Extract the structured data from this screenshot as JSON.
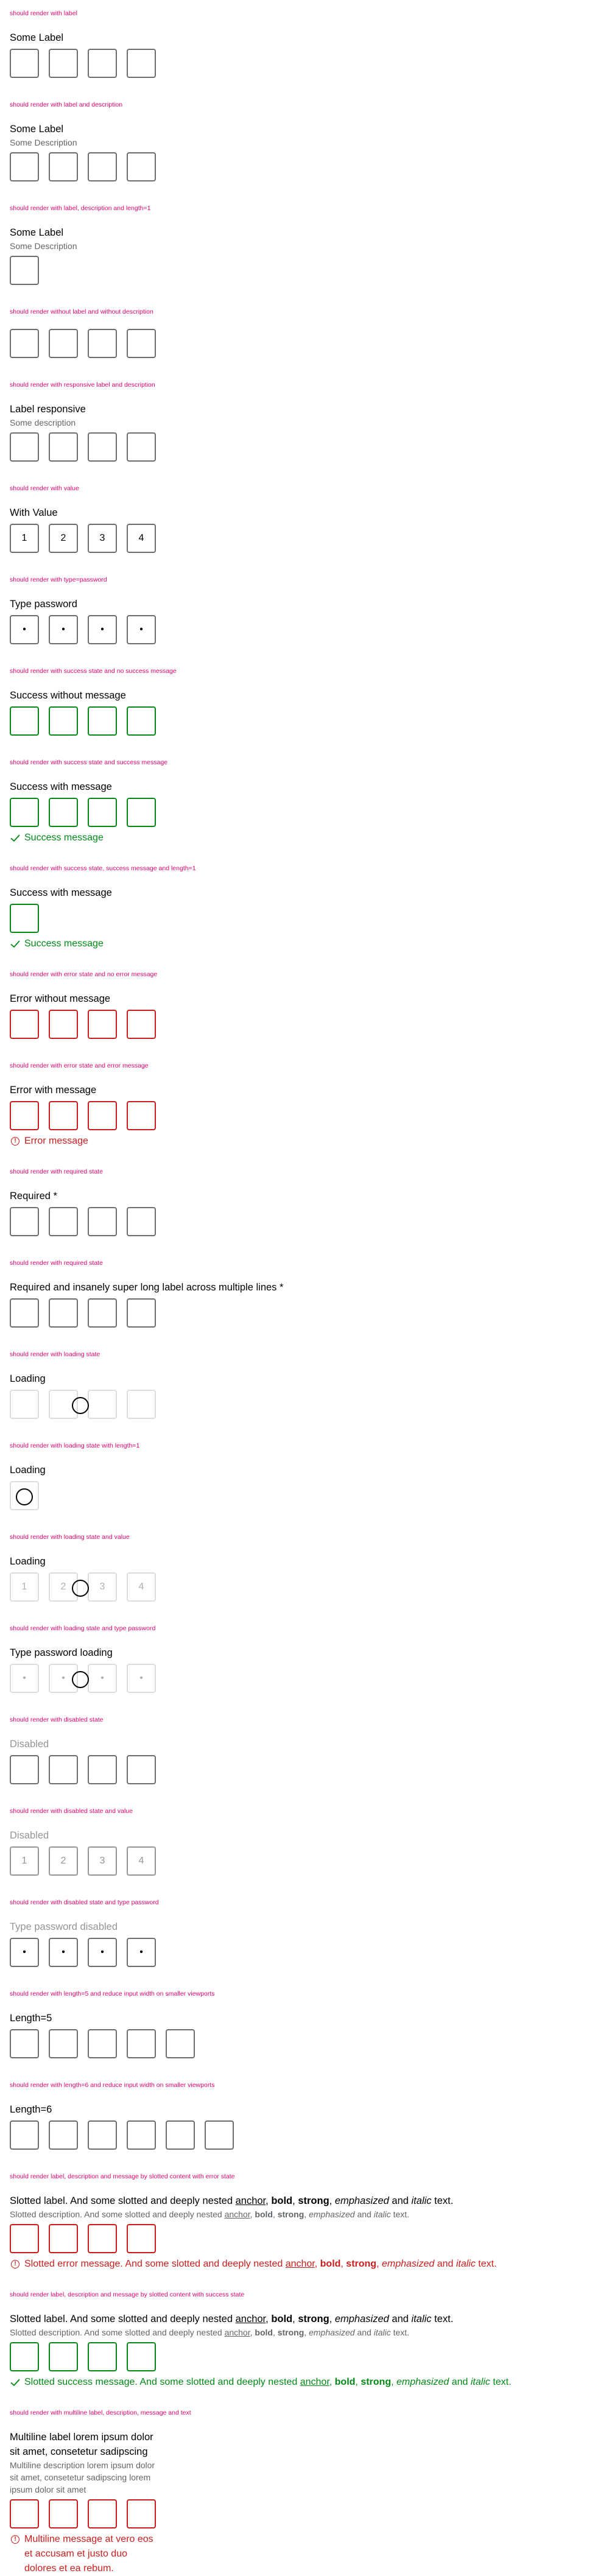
{
  "sections": {
    "s1": {
      "story": "should render with label",
      "label": "Some Label"
    },
    "s2": {
      "story": "should render with label and description",
      "label": "Some Label",
      "description": "Some Description"
    },
    "s3": {
      "story": "should render with label, description and length=1",
      "label": "Some Label",
      "description": "Some Description"
    },
    "s4": {
      "story": "should render without label and without description"
    },
    "s5": {
      "story": "should render with responsive label and description",
      "label": "Label responsive",
      "description": "Some description"
    },
    "s6": {
      "story": "should render with value",
      "label": "With Value",
      "values": [
        "1",
        "2",
        "3",
        "4"
      ]
    },
    "s7": {
      "story": "should render with type=password",
      "label": "Type password",
      "values": [
        "•",
        "•",
        "•",
        "•"
      ]
    },
    "s8": {
      "story": "should render with success state and no success message",
      "label": "Success without message"
    },
    "s9": {
      "story": "should render with success state and success message",
      "label": "Success with message",
      "message": "Success message"
    },
    "s10": {
      "story": "should render with success state, success message and length=1",
      "label": "Success with message",
      "message": "Success message"
    },
    "s11": {
      "story": "should render with error state and no error message",
      "label": "Error without message"
    },
    "s12": {
      "story": "should render with error state and error message",
      "label": "Error with message",
      "message": "Error message"
    },
    "s13": {
      "story": "should render with required state",
      "label": "Required *"
    },
    "s14": {
      "story": "should render with required state",
      "label": "Required and insanely super long label across multiple lines *"
    },
    "s15": {
      "story": "should render with loading state",
      "label": "Loading"
    },
    "s16": {
      "story": "should render with loading state with length=1",
      "label": "Loading"
    },
    "s17": {
      "story": "should render with loading state and value",
      "label": "Loading",
      "values": [
        "1",
        "2",
        "3",
        "4"
      ]
    },
    "s18": {
      "story": "should render with loading state and type password",
      "label": "Type password loading",
      "values": [
        "•",
        "•",
        "•",
        "•"
      ]
    },
    "s19": {
      "story": "should render with disabled state",
      "label": "Disabled"
    },
    "s20": {
      "story": "should render with disabled state and value",
      "label": "Disabled",
      "values": [
        "1",
        "2",
        "3",
        "4"
      ]
    },
    "s21": {
      "story": "should render with disabled state and type password",
      "label": "Type password disabled",
      "values": [
        "•",
        "•",
        "•",
        "•"
      ]
    },
    "s22": {
      "story": "should render with length=5 and reduce input width on smaller viewports",
      "label": "Length=5"
    },
    "s23": {
      "story": "should render with length=6 and reduce input width on smaller viewports",
      "label": "Length=6"
    },
    "s24": {
      "story": "should render label, description and message by slotted content with error state",
      "label": {
        "t1": "Slotted label. And some slotted and deeply nested ",
        "anchor": "anchor",
        "t2": ", ",
        "bold": "bold",
        "t3": ", ",
        "strong": "strong",
        "t4": ", ",
        "em": "emphasized",
        "t5": " and ",
        "italic": "italic",
        "t6": " text."
      },
      "description": {
        "t1": "Slotted description. And some slotted and deeply nested ",
        "anchor": "anchor",
        "t2": ", ",
        "bold": "bold",
        "t3": ", ",
        "strong": "strong",
        "t4": ", ",
        "em": "emphasized",
        "t5": " and ",
        "italic": "italic",
        "t6": " text."
      },
      "message": {
        "t1": "Slotted error message. And some slotted and deeply nested ",
        "anchor": "anchor",
        "t2": ", ",
        "bold": "bold",
        "t3": ", ",
        "strong": "strong",
        "t4": ", ",
        "em": "emphasized",
        "t5": " and ",
        "italic": "italic",
        "t6": " text."
      }
    },
    "s25": {
      "story": "should render label, description and message by slotted content with success state",
      "label": {
        "t1": "Slotted label. And some slotted and deeply nested ",
        "anchor": "anchor",
        "t2": ", ",
        "bold": "bold",
        "t3": ", ",
        "strong": "strong",
        "t4": ", ",
        "em": "emphasized",
        "t5": " and ",
        "italic": "italic",
        "t6": " text."
      },
      "description": {
        "t1": "Slotted description. And some slotted and deeply nested ",
        "anchor": "anchor",
        "t2": ", ",
        "bold": "bold",
        "t3": ", ",
        "strong": "strong",
        "t4": ", ",
        "em": "emphasized",
        "t5": " and ",
        "italic": "italic",
        "t6": " text."
      },
      "message": {
        "t1": "Slotted success message. And some slotted and deeply nested ",
        "anchor": "anchor",
        "t2": ", ",
        "bold": "bold",
        "t3": ", ",
        "strong": "strong",
        "t4": ", ",
        "em": "emphasized",
        "t5": " and ",
        "italic": "italic",
        "t6": " text."
      }
    },
    "s26": {
      "story": "should render with multiline label, description, message and text",
      "label": "Multiline label lorem ipsum dolor sit amet, consetetur sadipscing",
      "description": "Multiline description lorem ipsum dolor sit amet, consetetur sadipscing lorem ipsum dolor sit amet",
      "message": "Multiline message at vero eos et accusam et justo duo dolores et ea rebum."
    }
  },
  "colors": {
    "story": "#e0066e",
    "success": "#018a16",
    "error": "#cc1d1d",
    "border": "#6b6d70",
    "disabled": "#949598",
    "text": "#010205",
    "muted": "#626669"
  },
  "icons": {
    "success": "check-icon",
    "error": "exclamation-icon",
    "loading": "spinner-icon"
  }
}
